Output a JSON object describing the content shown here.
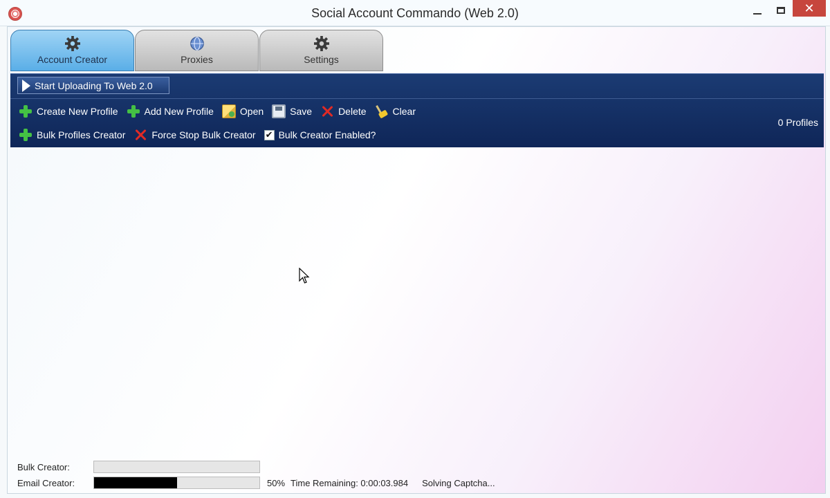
{
  "window": {
    "title": "Social Account Commando (Web 2.0)",
    "close_glyph": "✕"
  },
  "tabs": [
    {
      "label": "Account Creator",
      "icon": "gear-icon",
      "active": true
    },
    {
      "label": "Proxies",
      "icon": "globe-icon",
      "active": false
    },
    {
      "label": "Settings",
      "icon": "gear-icon",
      "active": false
    }
  ],
  "toolbar": {
    "start_label": "Start Uploading To Web 2.0",
    "row1": [
      {
        "label": "Create New Profile",
        "icon": "plus-icon"
      },
      {
        "label": "Add New Profile",
        "icon": "plus-icon"
      },
      {
        "label": "Open",
        "icon": "folder-open-icon"
      },
      {
        "label": "Save",
        "icon": "floppy-save-icon"
      },
      {
        "label": "Delete",
        "icon": "red-x-icon"
      },
      {
        "label": "Clear",
        "icon": "broom-icon"
      }
    ],
    "row2": [
      {
        "label": "Bulk Profiles Creator",
        "icon": "plus-icon"
      },
      {
        "label": "Force Stop Bulk Creator",
        "icon": "red-x-icon"
      }
    ],
    "bulk_enabled": {
      "label": "Bulk Creator Enabled?",
      "checked": true,
      "check_glyph": "✔"
    },
    "profiles_count": "0  Profiles"
  },
  "status": {
    "bulk_label": "Bulk Creator:",
    "bulk_progress": 0,
    "email_label": "Email Creator:",
    "email_progress": 0.5,
    "email_percent": "50%",
    "time_remaining": "Time Remaining: 0:00:03.984",
    "state": "Solving Captcha..."
  },
  "colors": {
    "toolbar_bg": "#0f2658",
    "active_tab": "#5aaee7",
    "close_button": "#c7463d"
  }
}
